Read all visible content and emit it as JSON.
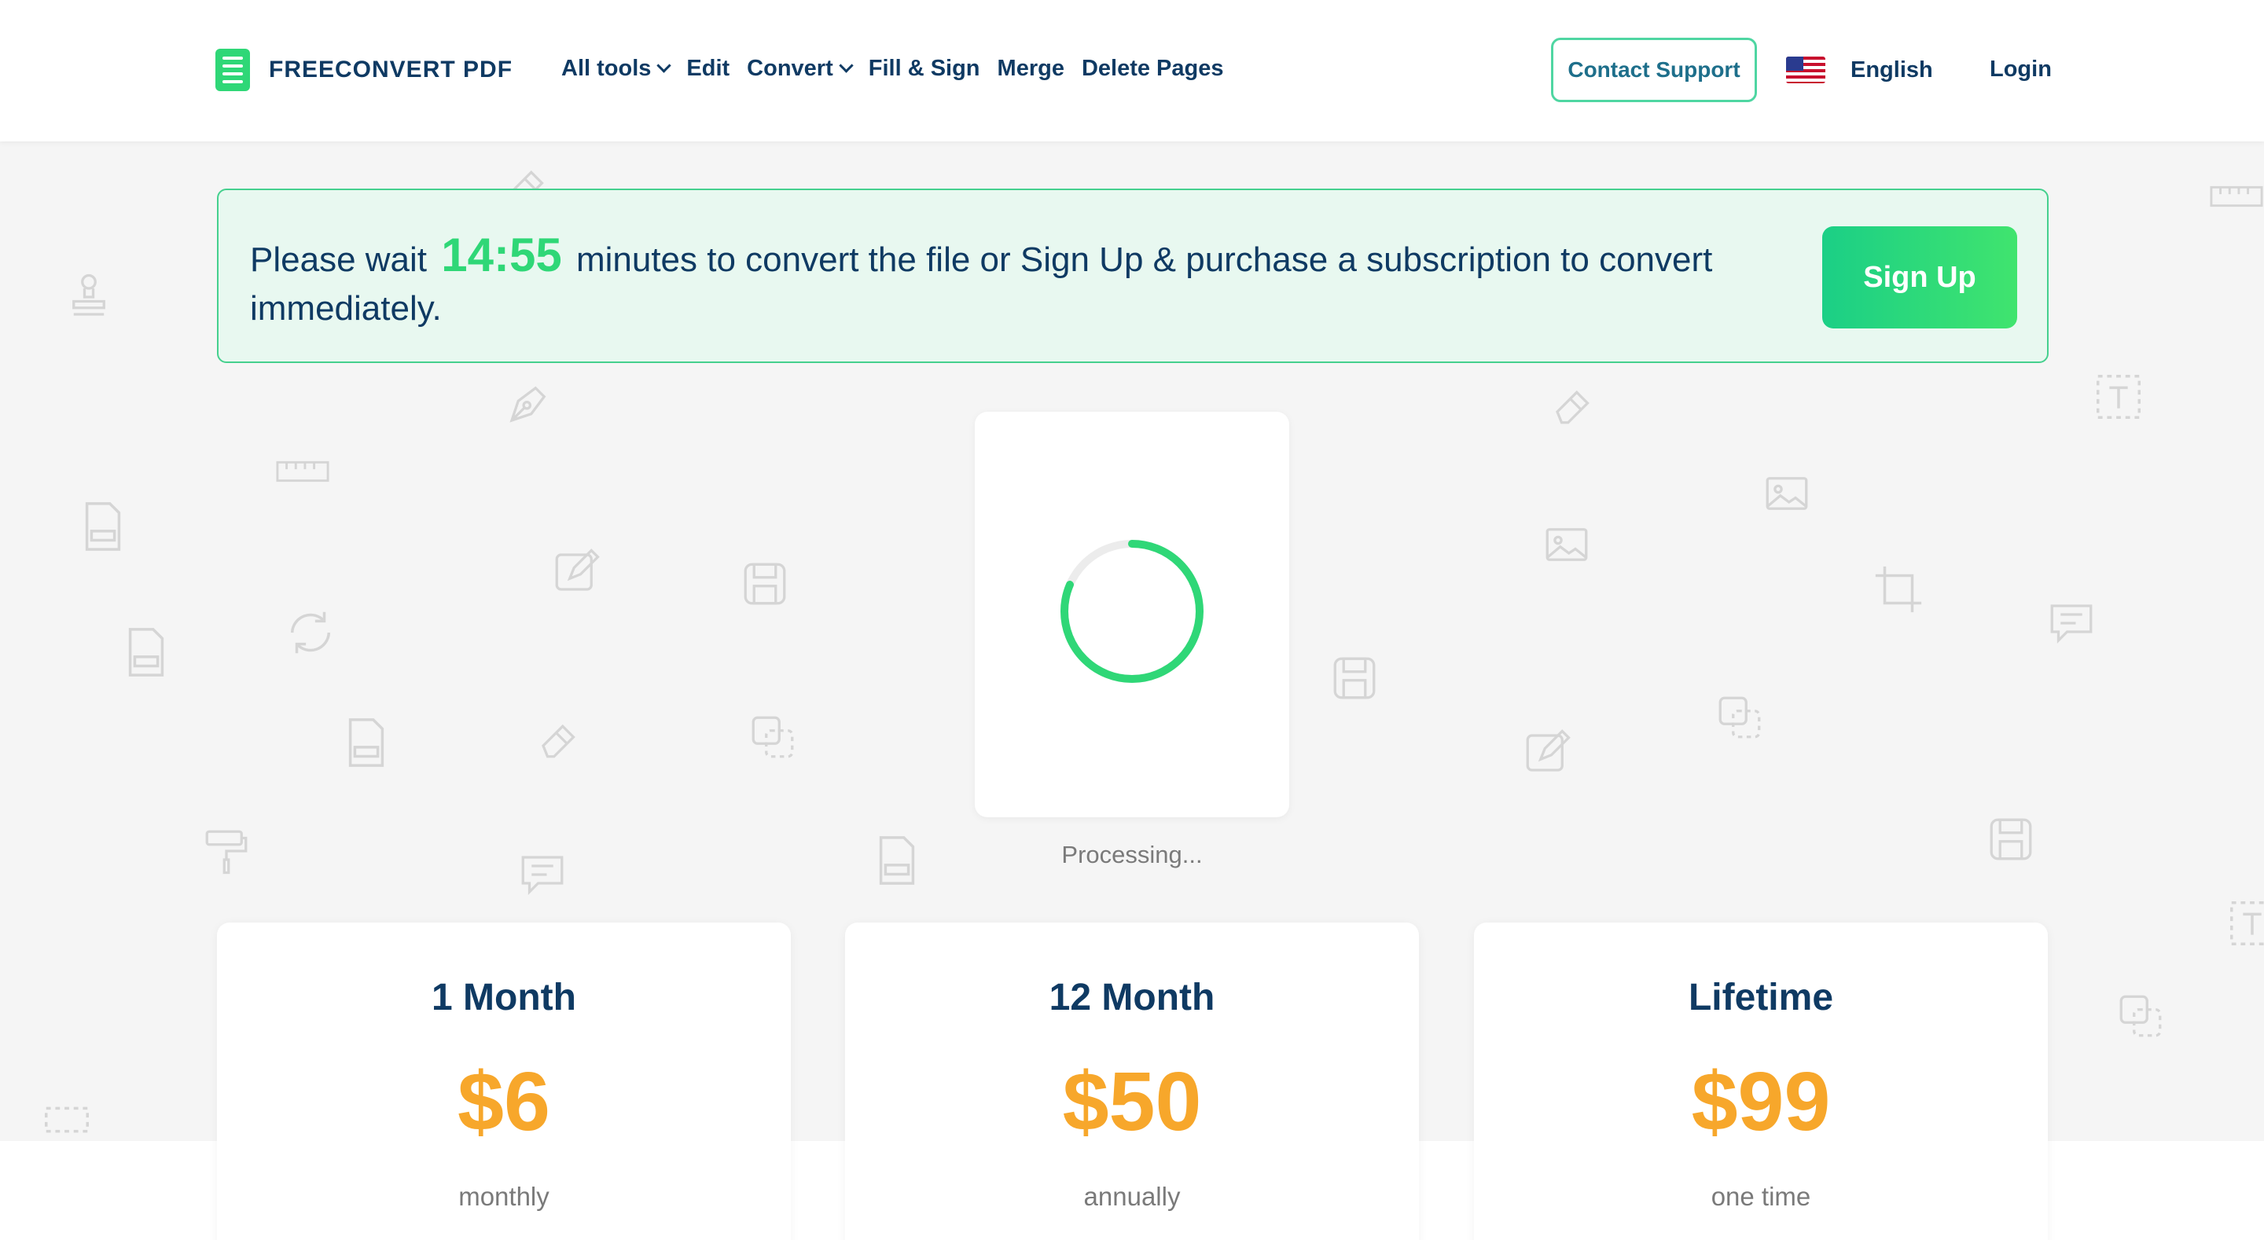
{
  "header": {
    "logo_text": "FREECONVERT PDF",
    "nav": [
      {
        "label": "All tools",
        "has_dropdown": true
      },
      {
        "label": "Edit",
        "has_dropdown": false
      },
      {
        "label": "Convert",
        "has_dropdown": true
      },
      {
        "label": "Fill & Sign",
        "has_dropdown": false
      },
      {
        "label": "Merge",
        "has_dropdown": false
      },
      {
        "label": "Delete Pages",
        "has_dropdown": false
      }
    ],
    "contact_support": "Contact Support",
    "language": "English",
    "login": "Login"
  },
  "notice": {
    "prefix": "Please wait",
    "timer": "14:55",
    "suffix": "minutes to convert the file or Sign Up & purchase a subscription to convert immediately.",
    "signup_button": "Sign Up"
  },
  "processing": {
    "status": "Processing..."
  },
  "plans": [
    {
      "name": "1 Month",
      "price": "$6",
      "period": "monthly"
    },
    {
      "name": "12 Month",
      "price": "$50",
      "period": "annually"
    },
    {
      "name": "Lifetime",
      "price": "$99",
      "period": "one time"
    }
  ],
  "colors": {
    "brand_green": "#2fd777",
    "navy": "#0f3a63",
    "price_orange": "#f7a72b",
    "notice_bg": "#e8f8f0"
  }
}
